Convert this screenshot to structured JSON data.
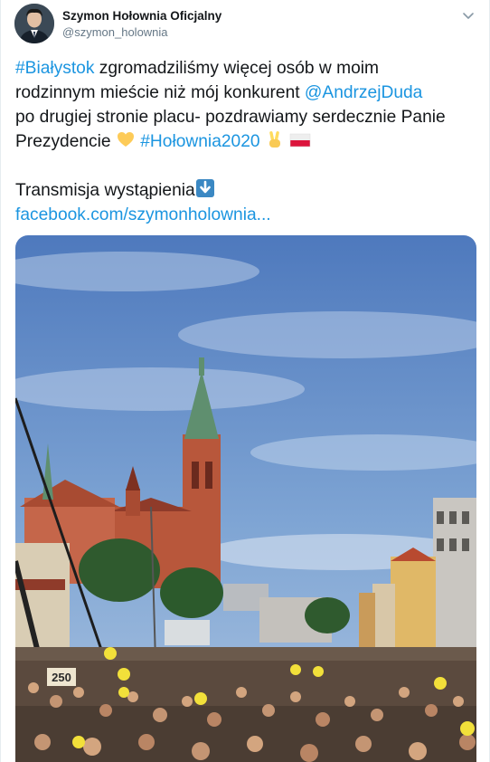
{
  "tweet": {
    "author": {
      "display_name": "Szymon Hołownia Oficjalny",
      "handle": "@szymon_holownia"
    },
    "text": {
      "line1_hashtag": "#Białystok",
      "line1_rest": " zgromadziliśmy więcej osób w moim",
      "line2_text": "rodzinnym mieście niż mój konkurent ",
      "line2_mention": "@AndrzejDuda",
      "line3_text": "po drugiej stronie placu- pozdrawiamy serdecznie Panie",
      "line4_text": "Prezydencie ",
      "line4_hashtag": "#Hołownia2020",
      "line6_text": "Transmisja wystąpienia",
      "line7_link": "facebook.com/szymonholownia..."
    },
    "emoji": {
      "yellow_heart": "yellow-heart-icon",
      "victory_hand": "victory-hand-icon",
      "poland_flag": "poland-flag-icon",
      "down_arrow": "down-arrow-icon"
    },
    "media": {
      "sign_text": "250"
    }
  },
  "colors": {
    "link": "#1b95e0",
    "text": "#14171a",
    "secondary": "#657786",
    "border": "#e6ecf0"
  }
}
